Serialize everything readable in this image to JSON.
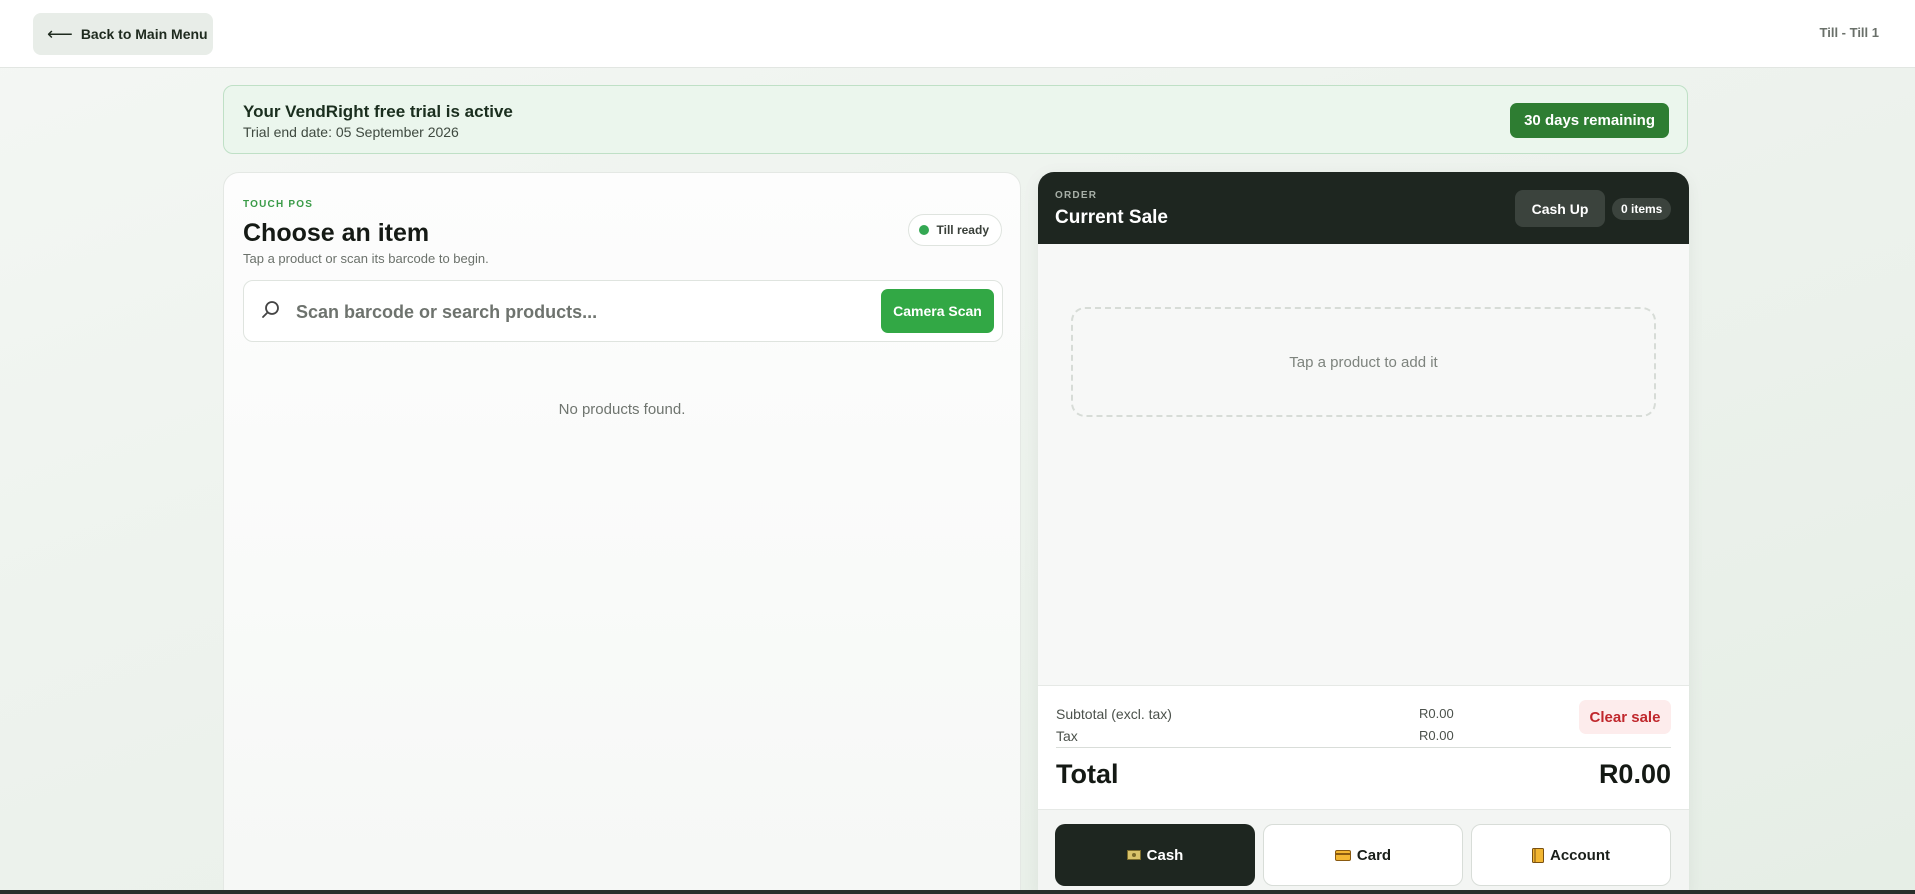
{
  "header": {
    "back_label": "Back to Main Menu",
    "back_arrow": "⟵",
    "till_label": "Till - Till 1"
  },
  "trial": {
    "title": "Your VendRight free trial is active",
    "subtitle": "Trial end date: 05 September 2026",
    "days_remaining": "30 days remaining"
  },
  "catalog": {
    "eyebrow": "TOUCH POS",
    "title": "Choose an item",
    "subtitle": "Tap a product or scan its barcode to begin.",
    "status": "Till ready",
    "search": {
      "placeholder": "Scan barcode or search products...",
      "value": ""
    },
    "camera_label": "Camera Scan",
    "empty_text": "No products found."
  },
  "order": {
    "eyebrow": "ORDER",
    "title": "Current Sale",
    "cash_up_label": "Cash Up",
    "items_count": "0 items",
    "empty_text": "Tap a product to add it",
    "subtotal_label": "Subtotal (excl. tax)",
    "subtotal_value": "R0.00",
    "tax_label": "Tax",
    "tax_value": "R0.00",
    "clear_label": "Clear sale",
    "total_label": "Total",
    "total_value": "R0.00",
    "payment": {
      "cash": "Cash",
      "card": "Card",
      "account": "Account"
    }
  },
  "colors": {
    "accent": "#32a845",
    "dark": "#1e2620",
    "danger": "#c0282d"
  }
}
